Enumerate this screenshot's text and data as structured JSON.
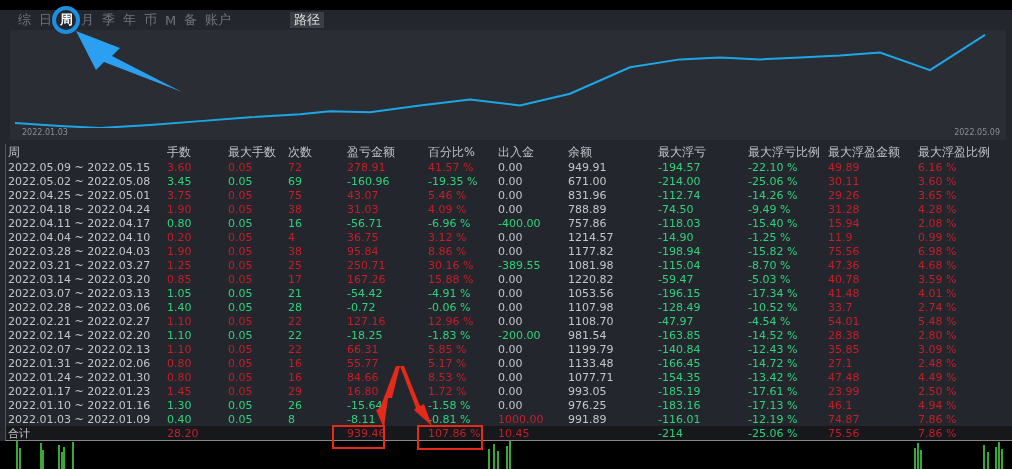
{
  "tabs": [
    {
      "label": "综",
      "selected": false
    },
    {
      "label": "日",
      "selected": false
    },
    {
      "label": "周",
      "selected": true
    },
    {
      "label": "月",
      "selected": false
    },
    {
      "label": "季",
      "selected": false
    },
    {
      "label": "年",
      "selected": false
    },
    {
      "label": "币",
      "selected": false
    },
    {
      "label": "M",
      "selected": false
    },
    {
      "label": "备",
      "selected": false
    },
    {
      "label": "账户",
      "selected": false
    }
  ],
  "path_button": "路径",
  "chart": {
    "start_label": "2022.01.03",
    "end_label": "2022.05.09"
  },
  "table": {
    "columns": [
      "周",
      "手数",
      "最大手数",
      "次数",
      "盈亏金额",
      "百分比%",
      "出入金",
      "余额",
      "最大浮亏",
      "最大浮亏比例",
      "最大浮盈金额",
      "最大浮盈比例"
    ],
    "rows": [
      {
        "kind": "profit",
        "cells": [
          "2022.05.09 ~ 2022.05.15",
          "3.60",
          "0.05",
          "72",
          "278.91",
          "41.57 %",
          {
            "text": "0.00",
            "kind": "none"
          },
          "949.91",
          "-194.57",
          "-22.10 %",
          "49.89",
          "6.16 %"
        ]
      },
      {
        "kind": "loss",
        "cells": [
          "2022.05.02 ~ 2022.05.08",
          "3.45",
          "0.05",
          "69",
          "-160.96",
          "-19.35 %",
          {
            "text": "0.00",
            "kind": "none"
          },
          "671.00",
          "-214.00",
          "-25.06 %",
          "30.11",
          "3.60 %"
        ]
      },
      {
        "kind": "profit",
        "cells": [
          "2022.04.25 ~ 2022.05.01",
          "3.75",
          "0.05",
          "75",
          "43.07",
          "5.46 %",
          {
            "text": "0.00",
            "kind": "none"
          },
          "831.96",
          "-112.74",
          "-14.26 %",
          "29.26",
          "3.65 %"
        ]
      },
      {
        "kind": "profit",
        "cells": [
          "2022.04.18 ~ 2022.04.24",
          "1.90",
          "0.05",
          "38",
          "31.03",
          "4.09 %",
          {
            "text": "0.00",
            "kind": "none"
          },
          "788.89",
          "-74.50",
          "-9.49 %",
          "31.28",
          "4.28 %"
        ]
      },
      {
        "kind": "loss",
        "cells": [
          "2022.04.11 ~ 2022.04.17",
          "0.80",
          "0.05",
          "16",
          "-56.71",
          "-6.96 %",
          {
            "text": "-400.00",
            "kind": "out"
          },
          "757.86",
          "-118.03",
          "-15.40 %",
          "15.94",
          "2.08 %"
        ]
      },
      {
        "kind": "profit",
        "cells": [
          "2022.04.04 ~ 2022.04.10",
          "0.20",
          "0.05",
          "4",
          "36.75",
          "3.12 %",
          {
            "text": "0.00",
            "kind": "none"
          },
          "1214.57",
          "-14.90",
          "-1.25 %",
          "11.9",
          "0.99 %"
        ]
      },
      {
        "kind": "profit",
        "cells": [
          "2022.03.28 ~ 2022.04.03",
          "1.90",
          "0.05",
          "38",
          "95.84",
          "8.86 %",
          {
            "text": "0.00",
            "kind": "none"
          },
          "1177.82",
          "-198.94",
          "-15.82 %",
          "75.56",
          "6.98 %"
        ]
      },
      {
        "kind": "profit",
        "cells": [
          "2022.03.21 ~ 2022.03.27",
          "1.25",
          "0.05",
          "25",
          "250.71",
          "30.16 %",
          {
            "text": "-389.55",
            "kind": "out"
          },
          "1081.98",
          "-115.04",
          "-8.70 %",
          "47.36",
          "4.68 %"
        ]
      },
      {
        "kind": "profit",
        "cells": [
          "2022.03.14 ~ 2022.03.20",
          "0.85",
          "0.05",
          "17",
          "167.26",
          "15.88 %",
          {
            "text": "0.00",
            "kind": "none"
          },
          "1220.82",
          "-59.47",
          "-5.03 %",
          "40.78",
          "3.59 %"
        ]
      },
      {
        "kind": "loss",
        "cells": [
          "2022.03.07 ~ 2022.03.13",
          "1.05",
          "0.05",
          "21",
          "-54.42",
          "-4.91 %",
          {
            "text": "0.00",
            "kind": "none"
          },
          "1053.56",
          "-196.15",
          "-17.34 %",
          "41.48",
          "4.01 %"
        ]
      },
      {
        "kind": "loss",
        "cells": [
          "2022.02.28 ~ 2022.03.06",
          "1.40",
          "0.05",
          "28",
          "-0.72",
          "-0.06 %",
          {
            "text": "0.00",
            "kind": "none"
          },
          "1107.98",
          "-128.49",
          "-10.52 %",
          "33.7",
          "2.74 %"
        ]
      },
      {
        "kind": "profit",
        "cells": [
          "2022.02.21 ~ 2022.02.27",
          "1.10",
          "0.05",
          "22",
          "127.16",
          "12.96 %",
          {
            "text": "0.00",
            "kind": "none"
          },
          "1108.70",
          "-47.97",
          "-4.54 %",
          "54.01",
          "5.48 %"
        ]
      },
      {
        "kind": "loss",
        "cells": [
          "2022.02.14 ~ 2022.02.20",
          "1.10",
          "0.05",
          "22",
          "-18.25",
          "-1.83 %",
          {
            "text": "-200.00",
            "kind": "out"
          },
          "981.54",
          "-163.85",
          "-14.52 %",
          "28.38",
          "2.80 %"
        ]
      },
      {
        "kind": "profit",
        "cells": [
          "2022.02.07 ~ 2022.02.13",
          "1.10",
          "0.05",
          "22",
          "66.31",
          "5.85 %",
          {
            "text": "0.00",
            "kind": "none"
          },
          "1199.79",
          "-140.84",
          "-12.43 %",
          "35.85",
          "3.09 %"
        ]
      },
      {
        "kind": "profit",
        "cells": [
          "2022.01.31 ~ 2022.02.06",
          "0.80",
          "0.05",
          "16",
          "55.77",
          "5.17 %",
          {
            "text": "0.00",
            "kind": "none"
          },
          "1133.48",
          "-166.45",
          "-14.72 %",
          "27.1",
          "2.48 %"
        ]
      },
      {
        "kind": "profit",
        "cells": [
          "2022.01.24 ~ 2022.01.30",
          "0.80",
          "0.05",
          "16",
          "84.66",
          "8.53 %",
          {
            "text": "0.00",
            "kind": "none"
          },
          "1077.71",
          "-154.35",
          "-13.42 %",
          "47.48",
          "4.49 %"
        ]
      },
      {
        "kind": "profit",
        "cells": [
          "2022.01.17 ~ 2022.01.23",
          "1.45",
          "0.05",
          "29",
          "16.80",
          "1.72 %",
          {
            "text": "0.00",
            "kind": "none"
          },
          "993.05",
          "-185.19",
          "-17.61 %",
          "23.99",
          "2.50 %"
        ]
      },
      {
        "kind": "loss",
        "cells": [
          "2022.01.10 ~ 2022.01.16",
          "1.30",
          "0.05",
          "26",
          "-15.64",
          "-1.58 %",
          {
            "text": "0.00",
            "kind": "none"
          },
          "976.25",
          "-183.16",
          "-17.13 %",
          "46.1",
          "4.94 %"
        ]
      },
      {
        "kind": "loss",
        "cells": [
          "2022.01.03 ~ 2022.01.09",
          "0.40",
          "0.05",
          "8",
          "-8.11",
          "-0.81 %",
          {
            "text": "1000.00",
            "kind": "in"
          },
          "991.89",
          "-116.01",
          "-12.19 %",
          "74.87",
          "7.86 %"
        ]
      }
    ],
    "total": {
      "kind": "profit",
      "cells": [
        "合计",
        "28.20",
        null,
        null,
        "939.46",
        "107.86 %",
        {
          "text": "10.45",
          "kind": "in"
        },
        null,
        "-214",
        "-25.06 %",
        "75.56",
        "7.86 %"
      ]
    }
  }
}
